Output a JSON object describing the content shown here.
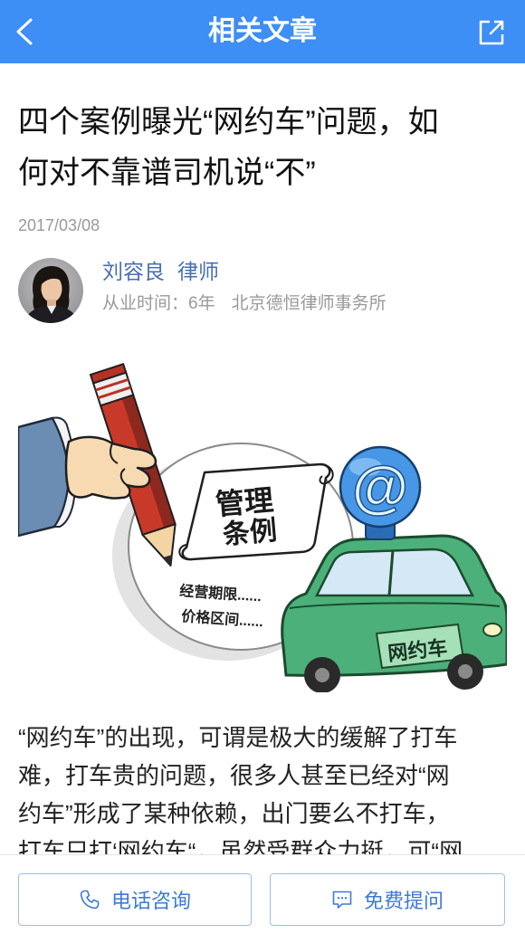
{
  "colors": {
    "accent": "#3d8ef5",
    "author_link": "#4670b0",
    "muted_text": "#999999",
    "button_text": "#3d7ad6",
    "button_border": "#9dbdee"
  },
  "header": {
    "title": "相关文章",
    "back_icon": "chevron-left-icon",
    "share_icon": "share-external-icon"
  },
  "article": {
    "title_lines": [
      "四个案例曝光“网约车”问题，如",
      "何对不靠谱司机说“不”"
    ],
    "date": "2017/03/08",
    "author": {
      "name": "刘容良",
      "role": "律师",
      "experience": "从业时间：6年",
      "firm": "北京德恒律师事务所"
    },
    "illustration": {
      "scroll_line_1": "管理",
      "scroll_line_2": "条例",
      "note_1": "经营期限......",
      "note_2": "价格区间......",
      "car_label": "网约车",
      "badge": "@"
    },
    "body_lines": [
      "“网约车”的出现，可谓是极大的缓解了打车",
      "难，打车贵的问题，很多人甚至已经对“网",
      "约车”形成了某种依赖，出门要么不打车，",
      "打车只打‘网约车“，虽然受群众力挺，可“网"
    ]
  },
  "bottom_bar": {
    "call_button": {
      "label": "电话咨询",
      "icon": "phone-icon"
    },
    "ask_button": {
      "label": "免费提问",
      "icon": "chat-bubble-icon"
    }
  }
}
